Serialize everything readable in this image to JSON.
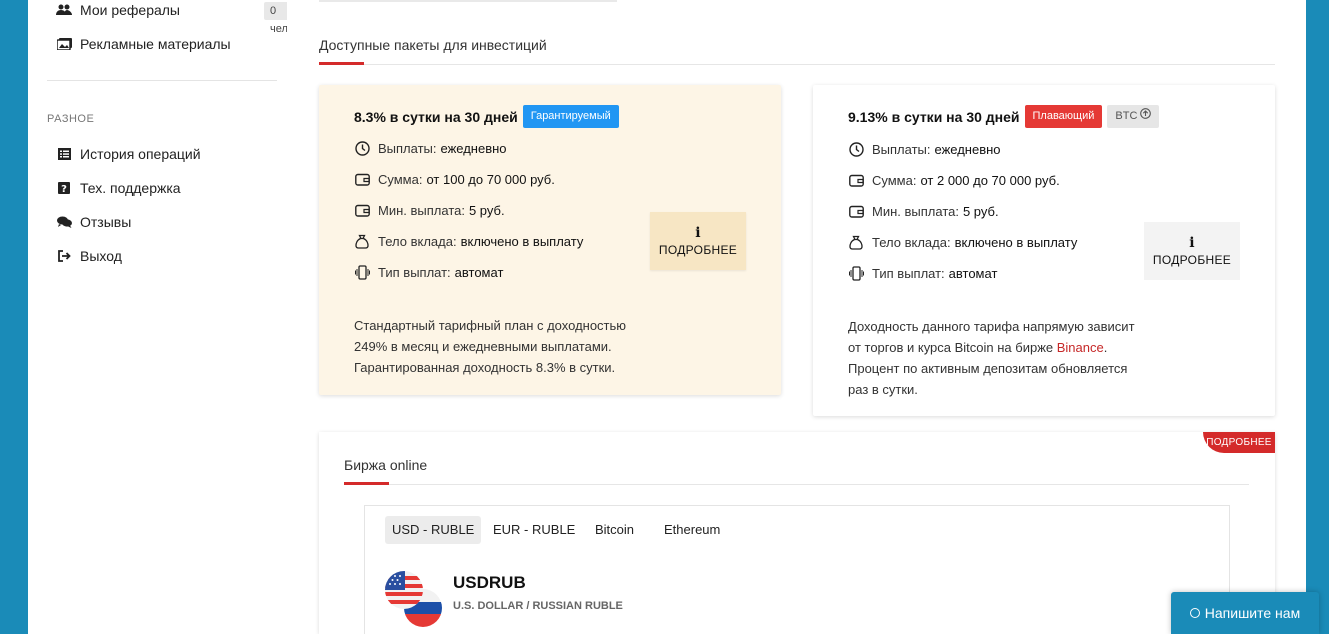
{
  "sidebar": {
    "items": [
      {
        "label": "Мои рефералы",
        "icon": "users-icon",
        "badge": "0 чел."
      },
      {
        "label": "Рекламные материалы",
        "icon": "images-icon"
      }
    ],
    "section_label": "РАЗНОЕ",
    "misc_items": [
      {
        "label": "История операций",
        "icon": "list-icon"
      },
      {
        "label": "Тех. поддержка",
        "icon": "question-icon"
      },
      {
        "label": "Отзывы",
        "icon": "comments-icon"
      },
      {
        "label": "Выход",
        "icon": "sign-out-icon"
      }
    ]
  },
  "packages": {
    "title": "Доступные пакеты для инвестиций",
    "cards": [
      {
        "title": "8.3% в сутки на 30 дней",
        "tag": "Гарантируемый",
        "features": [
          {
            "label": "Выплаты:",
            "value": "ежедневно",
            "icon": "clock-icon"
          },
          {
            "label": "Сумма:",
            "value": "от 100 до 70 000 руб.",
            "icon": "wallet-icon"
          },
          {
            "label": "Мин. выплата:",
            "value": "5 руб.",
            "icon": "wallet-icon"
          },
          {
            "label": "Тело вклада:",
            "value": "включено в выплату",
            "icon": "money-bag-icon"
          },
          {
            "label": "Тип выплат:",
            "value": "автомат",
            "icon": "phone-vibrate-icon"
          }
        ],
        "more_label": "ПОДРОБНЕЕ",
        "desc_line1": "Стандартный тарифный план с доходностью 249% в месяц и ежедневными выплатами.",
        "desc_line2": "Гарантированная доходность 8.3% в сутки."
      },
      {
        "title": "9.13% в сутки на 30 дней",
        "tag": "Плавающий",
        "tag2": "BTC",
        "features": [
          {
            "label": "Выплаты:",
            "value": "ежедневно",
            "icon": "clock-icon"
          },
          {
            "label": "Сумма:",
            "value": "от 2 000 до 70 000 руб.",
            "icon": "wallet-icon"
          },
          {
            "label": "Мин. выплата:",
            "value": "5 руб.",
            "icon": "wallet-icon"
          },
          {
            "label": "Тело вклада:",
            "value": "включено в выплату",
            "icon": "money-bag-icon"
          },
          {
            "label": "Тип выплат:",
            "value": "автомат",
            "icon": "phone-vibrate-icon"
          }
        ],
        "more_label": "ПОДРОБНЕЕ",
        "desc_part1": "Доходность данного тарифа напрямую зависит от торгов и курса Bitcoin на бирже ",
        "desc_link": "Binance",
        "desc_part2": ".",
        "desc_line2": "Процент по активным депозитам обновляется раз в сутки."
      }
    ]
  },
  "exchange": {
    "title": "Биржа online",
    "corner_label": "ПОДРОБНЕЕ",
    "tabs": [
      "USD - RUBLE",
      "EUR - RUBLE",
      "Bitcoin",
      "Ethereum"
    ],
    "active_tab": "USD - RUBLE",
    "pair": "USDRUB",
    "pair_desc": "U.S. DOLLAR / RUSSIAN RUBLE"
  },
  "chat": {
    "label": "Напишите нам"
  },
  "colors": {
    "accent": "#d42a2a",
    "frame": "#1a8bb8",
    "tag_blue": "#2196f3",
    "tag_red": "#e53935",
    "card_cream": "#fdf5e6"
  }
}
